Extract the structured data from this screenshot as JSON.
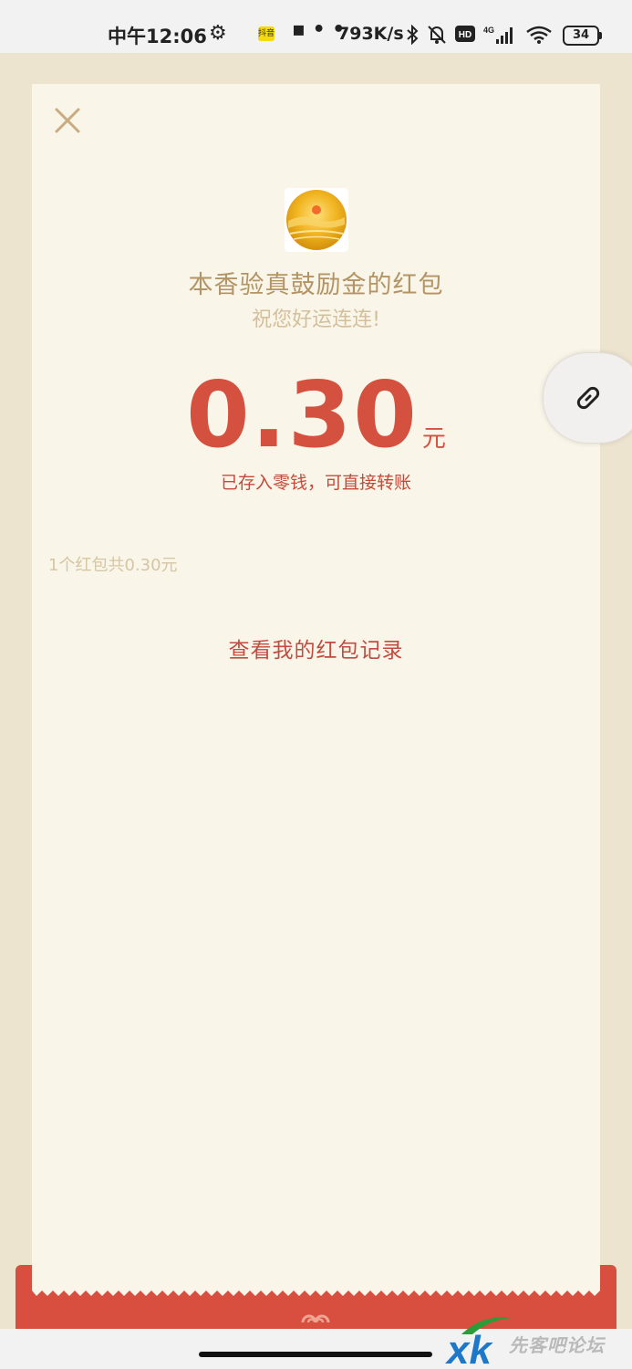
{
  "status_bar": {
    "time": "中午12:06",
    "app_badge": "抖音",
    "dots": "▪ • •",
    "net_speed": "793K/s",
    "battery": "34",
    "icons": [
      "gear-icon",
      "bluetooth-icon",
      "mute-icon",
      "hd-icon",
      "signal-4g-icon",
      "wifi-icon",
      "battery-icon"
    ]
  },
  "packet": {
    "sender_title": "本香验真鼓励金的红包",
    "greeting": "祝您好运连连!",
    "amount": "0.30",
    "unit": "元",
    "note": "已存入零钱，可直接转账",
    "summary": "1个红包共0.30元",
    "records_link": "查看我的红包记录"
  },
  "colors": {
    "background": "#ede4d0",
    "card": "#faf5e9",
    "amount_red": "#d4503f",
    "title_gold": "#b39465",
    "band_red": "#d84e3f"
  },
  "watermark": {
    "text": "先客吧论坛",
    "logo": "xk-logo"
  }
}
